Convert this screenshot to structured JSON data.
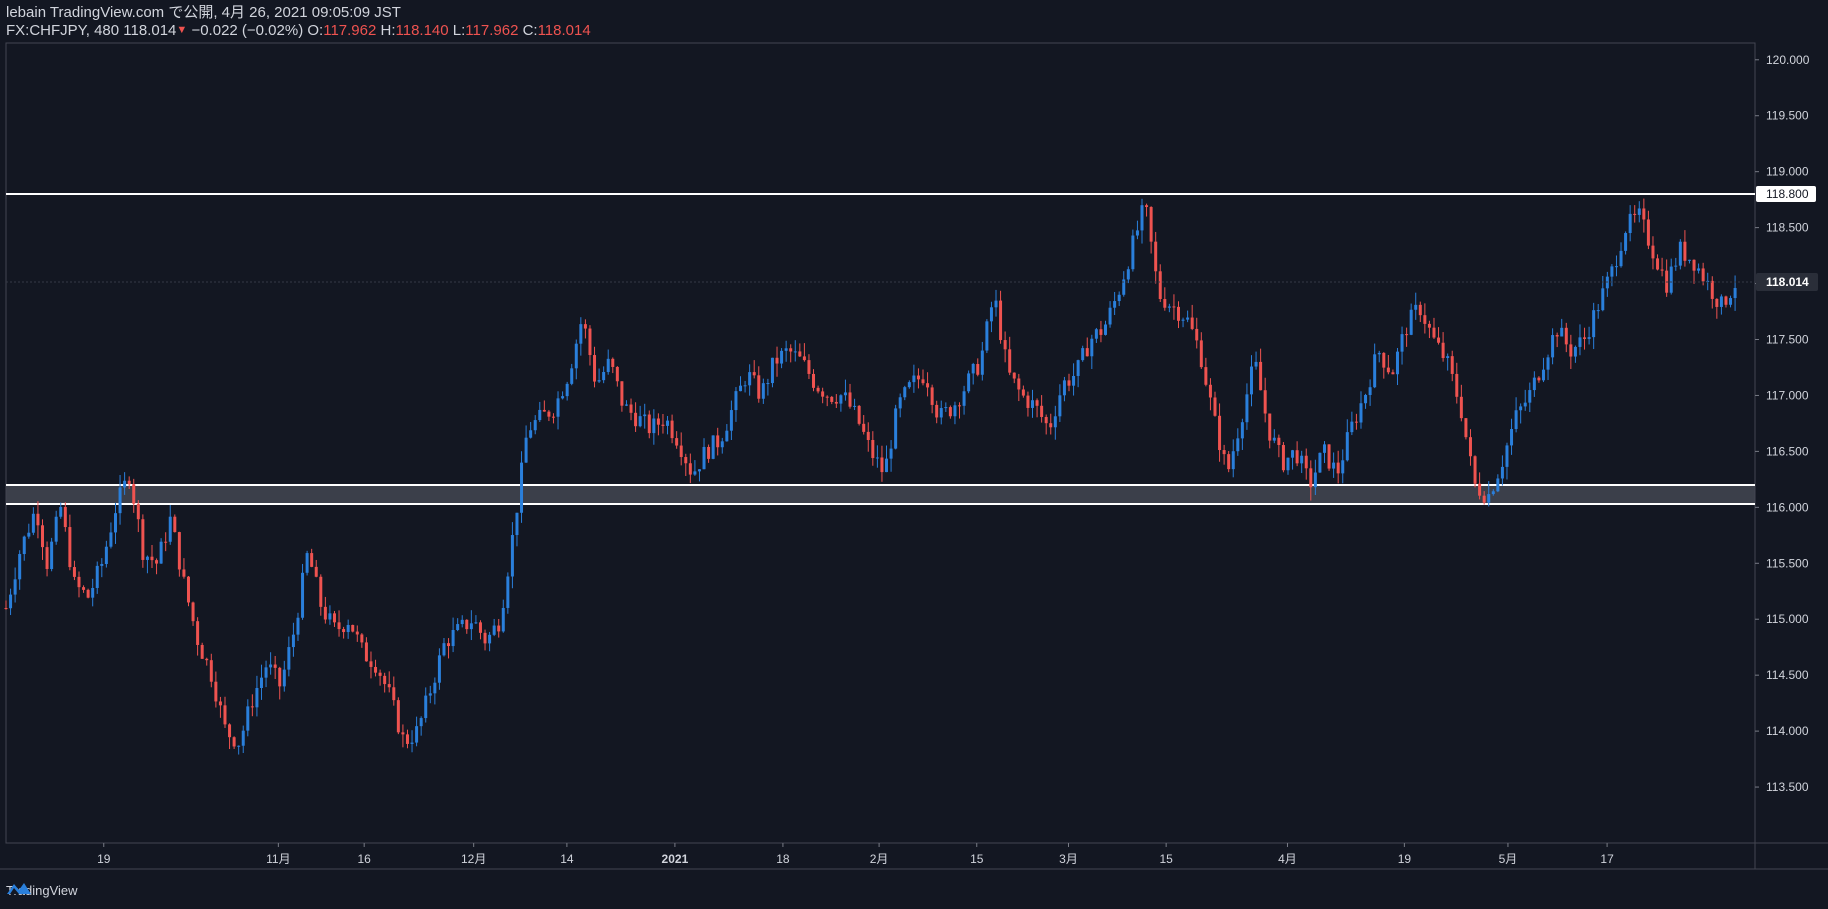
{
  "header": {
    "line1": "lebain TradingView.com で公開, 4月 26, 2021 09:05:09 JST",
    "symbol": "FX:CHFJPY, 480",
    "last": "118.014",
    "change_arrow": "▼",
    "change": "−0.022 (−0.02%)",
    "o_label": "O:",
    "o_value": "117.962",
    "h_label": "H:",
    "h_value": "118.140",
    "l_label": "L:",
    "l_value": "117.962",
    "c_label": "C:",
    "c_value": "118.014"
  },
  "footer": {
    "brand": "TradingView"
  },
  "colors": {
    "background": "#131722",
    "up": "#2a7fdb",
    "down": "#ef5350",
    "axis_text": "#d1d4dc",
    "grid": "#2a2e39",
    "level": "#ffffff",
    "zone_fill": "#434651"
  },
  "chart_data": {
    "type": "candlestick",
    "symbol": "FX:CHFJPY",
    "interval": "480",
    "ylim": [
      113.0,
      120.15
    ],
    "y_ticks": [
      "120.000",
      "119.500",
      "119.000",
      "118.500",
      "118.000",
      "117.500",
      "117.000",
      "116.500",
      "116.000",
      "115.500",
      "115.000",
      "114.500",
      "114.000",
      "113.500"
    ],
    "x_ticks": [
      "19",
      "11月",
      "16",
      "12月",
      "14",
      "2021",
      "18",
      "2月",
      "15",
      "3月",
      "15",
      "4月",
      "19",
      "5月",
      "17"
    ],
    "x_tick_positions": [
      0.012,
      0.13,
      0.188,
      0.262,
      0.325,
      0.398,
      0.471,
      0.536,
      0.602,
      0.664,
      0.73,
      0.812,
      0.891,
      0.961,
      1.028
    ],
    "horizontal_levels": [
      {
        "label": "118.800",
        "value": 118.8
      }
    ],
    "support_zone": {
      "top": 116.2,
      "bottom": 116.03
    },
    "last_price": {
      "label": "118.014",
      "value": 118.014
    },
    "price_path": [
      [
        0.0,
        115.1
      ],
      [
        0.01,
        115.6
      ],
      [
        0.022,
        116.0
      ],
      [
        0.03,
        115.5
      ],
      [
        0.04,
        116.0
      ],
      [
        0.05,
        115.3
      ],
      [
        0.06,
        115.2
      ],
      [
        0.07,
        115.5
      ],
      [
        0.08,
        116.0
      ],
      [
        0.09,
        116.3
      ],
      [
        0.1,
        115.6
      ],
      [
        0.11,
        115.5
      ],
      [
        0.12,
        115.9
      ],
      [
        0.13,
        115.3
      ],
      [
        0.14,
        114.8
      ],
      [
        0.15,
        114.5
      ],
      [
        0.16,
        114.0
      ],
      [
        0.17,
        113.9
      ],
      [
        0.18,
        114.3
      ],
      [
        0.19,
        114.6
      ],
      [
        0.2,
        114.4
      ],
      [
        0.21,
        114.9
      ],
      [
        0.22,
        115.6
      ],
      [
        0.23,
        115.1
      ],
      [
        0.24,
        114.9
      ],
      [
        0.25,
        115.0
      ],
      [
        0.26,
        114.7
      ],
      [
        0.27,
        114.6
      ],
      [
        0.28,
        114.3
      ],
      [
        0.29,
        113.9
      ],
      [
        0.3,
        114.0
      ],
      [
        0.31,
        114.4
      ],
      [
        0.32,
        114.8
      ],
      [
        0.33,
        114.9
      ],
      [
        0.34,
        115.0
      ],
      [
        0.35,
        114.8
      ],
      [
        0.36,
        115.0
      ],
      [
        0.37,
        115.8
      ],
      [
        0.38,
        116.7
      ],
      [
        0.39,
        116.8
      ],
      [
        0.4,
        116.9
      ],
      [
        0.41,
        117.2
      ],
      [
        0.42,
        117.7
      ],
      [
        0.43,
        117.1
      ],
      [
        0.44,
        117.3
      ],
      [
        0.45,
        116.9
      ],
      [
        0.46,
        116.8
      ],
      [
        0.47,
        116.7
      ],
      [
        0.48,
        116.8
      ],
      [
        0.49,
        116.6
      ],
      [
        0.5,
        116.3
      ],
      [
        0.51,
        116.5
      ],
      [
        0.52,
        116.6
      ],
      [
        0.53,
        116.9
      ],
      [
        0.54,
        117.2
      ],
      [
        0.55,
        117.0
      ],
      [
        0.56,
        117.3
      ],
      [
        0.57,
        117.4
      ],
      [
        0.58,
        117.3
      ],
      [
        0.59,
        117.1
      ],
      [
        0.6,
        117.0
      ],
      [
        0.61,
        117.0
      ],
      [
        0.62,
        116.8
      ],
      [
        0.63,
        116.5
      ],
      [
        0.64,
        116.3
      ],
      [
        0.65,
        116.9
      ],
      [
        0.66,
        117.1
      ],
      [
        0.67,
        117.2
      ],
      [
        0.68,
        116.8
      ],
      [
        0.69,
        116.9
      ],
      [
        0.7,
        117.1
      ],
      [
        0.71,
        117.3
      ],
      [
        0.72,
        117.9
      ],
      [
        0.73,
        117.2
      ],
      [
        0.74,
        117.0
      ],
      [
        0.75,
        116.9
      ],
      [
        0.76,
        116.7
      ],
      [
        0.77,
        117.1
      ],
      [
        0.78,
        117.2
      ],
      [
        0.79,
        117.5
      ],
      [
        0.8,
        117.6
      ],
      [
        0.81,
        117.9
      ],
      [
        0.82,
        118.3
      ],
      [
        0.83,
        118.7
      ],
      [
        0.84,
        117.9
      ],
      [
        0.85,
        117.8
      ],
      [
        0.86,
        117.7
      ],
      [
        0.87,
        117.4
      ],
      [
        0.88,
        116.8
      ],
      [
        0.89,
        116.3
      ],
      [
        0.9,
        116.8
      ],
      [
        0.91,
        117.3
      ],
      [
        0.92,
        116.7
      ],
      [
        0.93,
        116.4
      ],
      [
        0.94,
        116.5
      ],
      [
        0.95,
        116.2
      ],
      [
        0.96,
        116.5
      ],
      [
        0.97,
        116.3
      ],
      [
        0.98,
        116.7
      ],
      [
        0.99,
        117.0
      ],
      [
        1.0,
        117.4
      ],
      [
        1.01,
        117.2
      ],
      [
        1.02,
        117.6
      ],
      [
        1.03,
        117.8
      ],
      [
        1.04,
        117.5
      ],
      [
        1.05,
        117.3
      ],
      [
        1.06,
        116.9
      ],
      [
        1.07,
        116.2
      ],
      [
        1.08,
        116.1
      ],
      [
        1.09,
        116.4
      ],
      [
        1.1,
        116.8
      ],
      [
        1.11,
        117.0
      ],
      [
        1.12,
        117.3
      ],
      [
        1.13,
        117.6
      ],
      [
        1.14,
        117.4
      ],
      [
        1.15,
        117.5
      ],
      [
        1.16,
        117.8
      ],
      [
        1.17,
        118.1
      ],
      [
        1.18,
        118.5
      ],
      [
        1.19,
        118.6
      ],
      [
        1.2,
        118.3
      ],
      [
        1.21,
        118.0
      ],
      [
        1.22,
        118.3
      ],
      [
        1.23,
        118.2
      ],
      [
        1.24,
        118.0
      ],
      [
        1.25,
        117.8
      ],
      [
        1.26,
        118.0
      ]
    ]
  }
}
